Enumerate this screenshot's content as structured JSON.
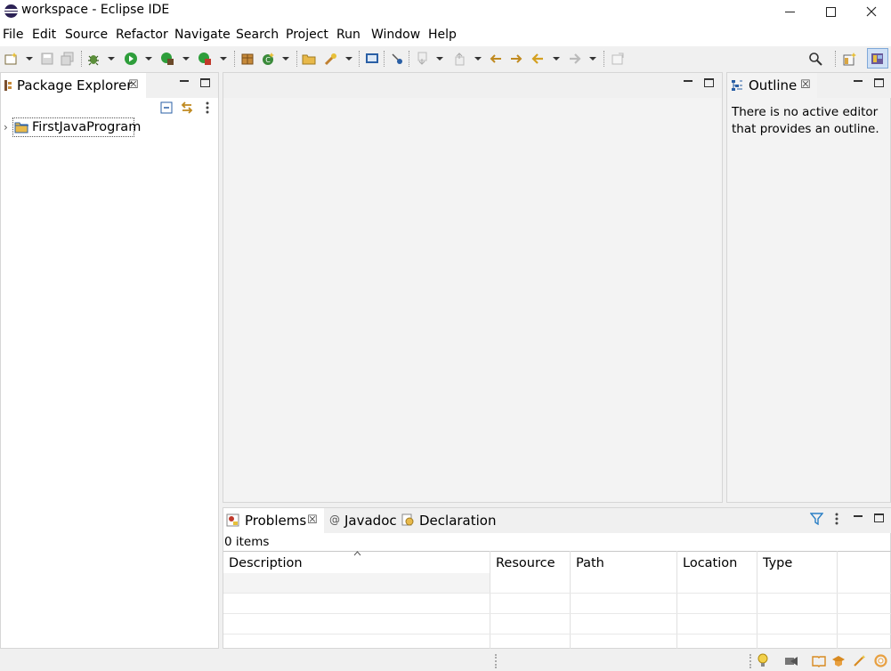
{
  "window": {
    "title": "workspace - Eclipse IDE"
  },
  "menubar": {
    "items": [
      {
        "label": "File"
      },
      {
        "label": "Edit"
      },
      {
        "label": "Source"
      },
      {
        "label": "Refactor"
      },
      {
        "label": "Navigate"
      },
      {
        "label": "Search"
      },
      {
        "label": "Project"
      },
      {
        "label": "Run"
      },
      {
        "label": "Window"
      },
      {
        "label": "Help"
      }
    ]
  },
  "package_explorer": {
    "tab_label": "Package Explorer",
    "tree": [
      {
        "label": "FirstJavaProgram"
      }
    ]
  },
  "outline": {
    "tab_label": "Outline",
    "message_line1": "There is no active editor",
    "message_line2": "that provides an outline."
  },
  "bottom": {
    "tabs": [
      {
        "label": "Problems"
      },
      {
        "label": "Javadoc"
      },
      {
        "label": "Declaration"
      }
    ],
    "item_count": "0 items",
    "columns": [
      {
        "label": "Description"
      },
      {
        "label": "Resource"
      },
      {
        "label": "Path"
      },
      {
        "label": "Location"
      },
      {
        "label": "Type"
      }
    ]
  },
  "colors": {
    "accent_blue": "#1f6fc5",
    "run_green": "#2e9e3b",
    "folder_yellow": "#e8b94a",
    "eclipse_purple": "#2c2255"
  },
  "icons": [
    "eclipse-logo-icon",
    "new-icon",
    "save-icon",
    "save-all-icon",
    "debug-icon",
    "run-icon",
    "coverage-icon",
    "external-tools-icon",
    "new-java-package-icon",
    "new-java-class-icon",
    "open-type-icon",
    "search-tool-icon",
    "open-console-icon",
    "toggle-breakpoint-icon",
    "next-annotation-icon",
    "prev-annotation-icon",
    "last-edit-icon",
    "back-icon",
    "forward-icon",
    "pin-icon",
    "search-icon",
    "open-perspective-icon",
    "java-perspective-icon",
    "collapse-all-icon",
    "link-editor-icon",
    "view-menu-icon",
    "folder-project-icon",
    "filter-icon",
    "tip-icon",
    "update-icon",
    "welcome-icon",
    "tutorial-icon",
    "wand-icon",
    "lifebuoy-icon"
  ]
}
